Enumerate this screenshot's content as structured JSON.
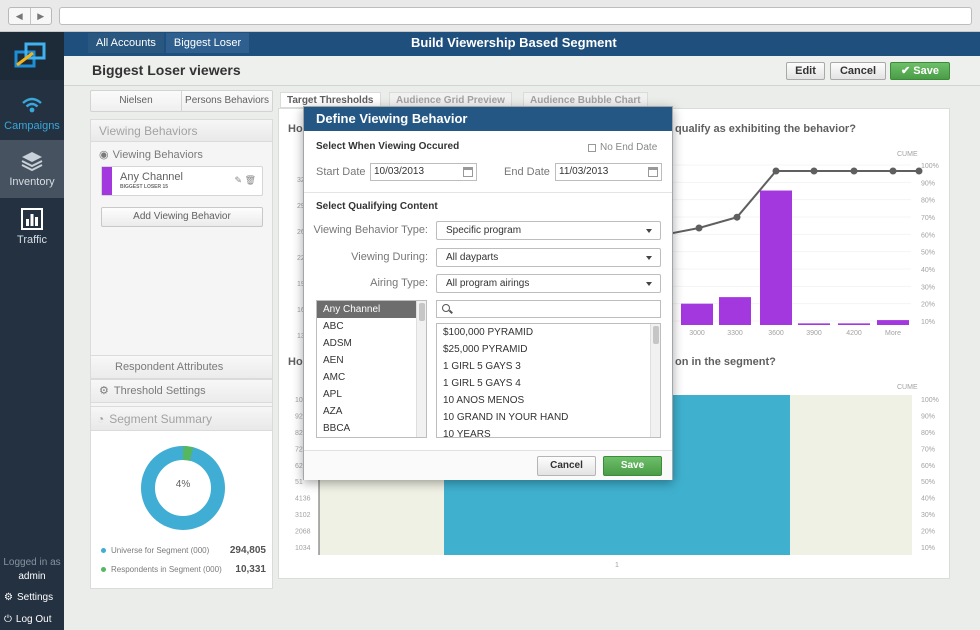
{
  "header": {
    "breadcrumbs": [
      "All Accounts",
      "Biggest Loser"
    ],
    "band_title": "Build Viewership Based Segment",
    "page_title": "Biggest Loser viewers",
    "edit_label": "Edit",
    "cancel_label": "Cancel",
    "save_label": "Save"
  },
  "leftnav": {
    "items": [
      {
        "label": "Campaigns",
        "icon": "wifi-icon"
      },
      {
        "label": "Inventory",
        "icon": "layers-icon"
      },
      {
        "label": "Traffic",
        "icon": "bar-chart-icon"
      }
    ],
    "logged_in_label": "Logged in as",
    "user": "admin",
    "settings_label": "Settings",
    "logout_label": "Log Out"
  },
  "left_panel": {
    "subtabs": [
      "Nielsen",
      "Persons Behaviors"
    ],
    "viewing_behaviors_header": "Viewing Behaviors",
    "viewing_behaviors_sub": "Viewing Behaviors",
    "behavior_card": {
      "name": "Any Channel",
      "sub": "BIGGEST LOSER 15",
      "color": "#8b00d6"
    },
    "add_button": "Add Viewing Behavior",
    "respondent_attributes": "Respondent Attributes",
    "threshold_settings": "Threshold Settings",
    "segment_summary": "Segment Summary",
    "donut_percent": "4%",
    "donut_fraction": 0.04,
    "legend": [
      {
        "label": "Universe for Segment (000)",
        "value": "294,805",
        "color": "#0a96c8"
      },
      {
        "label": "Respondents in Segment (000)",
        "value": "10,331",
        "color": "#27a338"
      }
    ]
  },
  "right": {
    "tabs": [
      "Target Thresholds",
      "Audience Grid Preview",
      "Audience Bubble Chart"
    ],
    "q1_left": "Ho",
    "q1_right": "qualify as exhibiting the behavior?",
    "q2_left": "Ho",
    "q2_right": "on in the segment?",
    "cume_label": "CUME"
  },
  "chart_data": [
    {
      "type": "bar",
      "categories": [
        "3000",
        "3300",
        "3600",
        "3900",
        "4200",
        "More"
      ],
      "values": [
        13,
        17,
        82,
        1,
        1,
        3
      ],
      "cume_right_axis": [
        "100%",
        "90%",
        "80%",
        "70%",
        "60%",
        "50%",
        "40%",
        "30%",
        "20%",
        "10%"
      ],
      "line_values": [
        58,
        63,
        70,
        100,
        100,
        100,
        100,
        100
      ],
      "left_axis_partial": [
        "32",
        "29",
        "26",
        "22",
        "19",
        "16",
        "13"
      ],
      "ylim": [
        0,
        100
      ]
    },
    {
      "type": "bar",
      "left_axis": [
        "103",
        "92",
        "82",
        "72",
        "62",
        "51",
        "4136",
        "3102",
        "2068",
        "1034"
      ],
      "cume_right_axis": [
        "100%",
        "90%",
        "80%",
        "70%",
        "60%",
        "50%",
        "40%",
        "30%",
        "20%",
        "10%"
      ],
      "x_label": "1",
      "colors": {
        "bar": "#0a9bc2",
        "band": "#ecedde"
      }
    }
  ],
  "modal": {
    "title": "Define Viewing Behavior",
    "section1": "Select When Viewing Occured",
    "no_end_date": "No End Date",
    "start_label": "Start Date",
    "start_value": "10/03/2013",
    "end_label": "End Date",
    "end_value": "11/03/2013",
    "section2": "Select Qualifying Content",
    "type_label": "Viewing Behavior Type:",
    "type_value": "Specific program",
    "during_label": "Viewing During:",
    "during_value": "All dayparts",
    "airing_label": "Airing Type:",
    "airing_value": "All program airings",
    "channels": [
      "Any Channel",
      "ABC",
      "ADSM",
      "AEN",
      "AMC",
      "APL",
      "AZA",
      "BBCA"
    ],
    "programs": [
      "$100,000 PYRAMID",
      "$25,000 PYRAMID",
      "1 GIRL 5 GAYS 3",
      "1 GIRL 5 GAYS 4",
      "10 ANOS MENOS",
      "10 GRAND IN YOUR HAND",
      "10 YEARS"
    ],
    "cancel_label": "Cancel",
    "save_label": "Save"
  }
}
